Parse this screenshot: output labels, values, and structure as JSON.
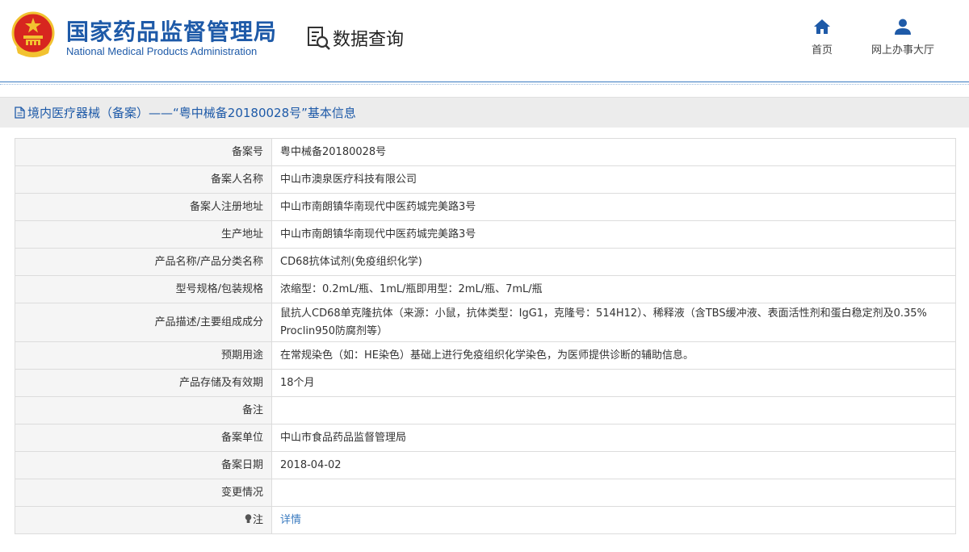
{
  "header": {
    "logo_cn": "国家药品监督管理局",
    "logo_en": "National Medical Products Administration",
    "query_label": "数据查询",
    "nav": [
      {
        "label": "首页",
        "icon": "home-icon"
      },
      {
        "label": "网上办事大厅",
        "icon": "user-icon"
      }
    ]
  },
  "page": {
    "title": "境内医疗器械（备案）——“粤中械备20180028号”基本信息"
  },
  "table": {
    "rows": [
      {
        "label": "备案号",
        "value": "粤中械备20180028号"
      },
      {
        "label": "备案人名称",
        "value": "中山市澳泉医疗科技有限公司"
      },
      {
        "label": "备案人注册地址",
        "value": "中山市南朗镇华南现代中医药城完美路3号"
      },
      {
        "label": "生产地址",
        "value": "中山市南朗镇华南现代中医药城完美路3号"
      },
      {
        "label": "产品名称/产品分类名称",
        "value": "CD68抗体试剂(免疫组织化学)"
      },
      {
        "label": "型号规格/包装规格",
        "value": "浓缩型：0.2mL/瓶、1mL/瓶即用型：2mL/瓶、7mL/瓶"
      },
      {
        "label": "产品描述/主要组成成分",
        "value": "鼠抗人CD68单克隆抗体（来源：小鼠，抗体类型：IgG1，克隆号：514H12）、稀释液（含TBS缓冲液、表面活性剂和蛋白稳定剂及0.35% Proclin950防腐剂等）"
      },
      {
        "label": "预期用途",
        "value": "在常规染色（如：HE染色）基础上进行免疫组织化学染色，为医师提供诊断的辅助信息。"
      },
      {
        "label": "产品存储及有效期",
        "value": "18个月"
      },
      {
        "label": "备注",
        "value": ""
      },
      {
        "label": "备案单位",
        "value": "中山市食品药品监督管理局"
      },
      {
        "label": "备案日期",
        "value": "2018-04-02"
      },
      {
        "label": "变更情况",
        "value": ""
      }
    ],
    "note_label": "注",
    "note_link": "详情"
  },
  "colors": {
    "brand_blue": "#1e5aa8",
    "link_blue": "#3a7bc0",
    "emblem_red": "#d7261f",
    "emblem_gold": "#f2c230"
  }
}
